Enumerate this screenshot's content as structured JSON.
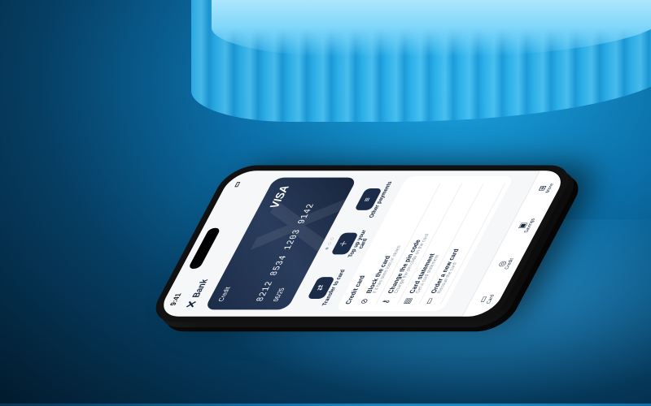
{
  "status": {
    "time": "9:41"
  },
  "header": {
    "brand": "Bank"
  },
  "card": {
    "type": "Credit",
    "network": "VISA",
    "number": "8212 8534 1203 9142",
    "expiry": "06/25"
  },
  "actions": [
    {
      "label": "Transfer to card",
      "icon": "transfer-icon"
    },
    {
      "label": "Top up your card",
      "icon": "topup-icon"
    },
    {
      "label": "Other payments",
      "icon": "payments-icon"
    }
  ],
  "section": {
    "title": "Credit card",
    "items": [
      {
        "title": "Block the card",
        "subtitle": "If it has been lost or stolen",
        "icon": "block-icon"
      },
      {
        "title": "Change the pin code",
        "subtitle": "Change the pin code on the card",
        "icon": "key-icon"
      },
      {
        "title": "Card statement",
        "subtitle": "Get a card statement",
        "icon": "document-icon"
      },
      {
        "title": "Order a new card",
        "subtitle": "Reissue the card",
        "icon": "card-icon"
      }
    ]
  },
  "tabbar": [
    {
      "label": "Card",
      "icon": "card-icon"
    },
    {
      "label": "Credit",
      "icon": "credit-icon"
    },
    {
      "label": "Savings",
      "icon": "savings-icon"
    },
    {
      "label": "More",
      "icon": "more-icon"
    }
  ]
}
